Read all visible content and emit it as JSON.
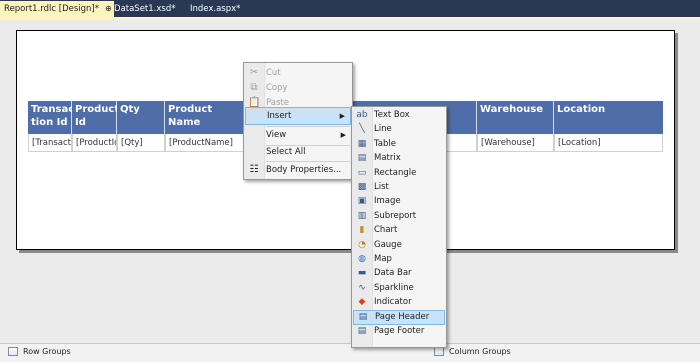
{
  "tabs": [
    {
      "label": "Report1.rdlc [Design]*",
      "active": true
    },
    {
      "label": "DataSet1.xsd*",
      "active": false
    },
    {
      "label": "Index.aspx*",
      "active": false
    }
  ],
  "tablix": {
    "headers": [
      "Transac tion Id",
      "Product Id",
      "Qty",
      "Product Name",
      "",
      "",
      "Warehouse",
      "Location"
    ],
    "row": [
      "[Transactic",
      "[ProductId]",
      "[Qty]",
      "[ProductName]",
      "",
      "",
      "[Warehouse]",
      "[Location]"
    ]
  },
  "context_menu": {
    "items": [
      {
        "label": "Cut",
        "icon": "cut-icon",
        "enabled": false
      },
      {
        "label": "Copy",
        "icon": "copy-icon",
        "enabled": false
      },
      {
        "label": "Paste",
        "icon": "paste-icon",
        "enabled": false
      },
      {
        "label": "Insert",
        "icon": "",
        "enabled": true,
        "submenu": true,
        "highlighted": true
      },
      {
        "label": "View",
        "icon": "",
        "enabled": true,
        "submenu": true
      },
      {
        "label": "Select All",
        "icon": "",
        "enabled": true
      },
      {
        "label": "Body Properties...",
        "icon": "properties-icon",
        "enabled": true
      }
    ]
  },
  "insert_submenu": {
    "items": [
      {
        "label": "Text Box",
        "icon": "textbox-icon"
      },
      {
        "label": "Line",
        "icon": "line-icon"
      },
      {
        "label": "Table",
        "icon": "table-icon"
      },
      {
        "label": "Matrix",
        "icon": "matrix-icon"
      },
      {
        "label": "Rectangle",
        "icon": "rectangle-icon"
      },
      {
        "label": "List",
        "icon": "list-icon"
      },
      {
        "label": "Image",
        "icon": "image-icon"
      },
      {
        "label": "Subreport",
        "icon": "subreport-icon"
      },
      {
        "label": "Chart",
        "icon": "chart-icon"
      },
      {
        "label": "Gauge",
        "icon": "gauge-icon"
      },
      {
        "label": "Map",
        "icon": "map-icon"
      },
      {
        "label": "Data Bar",
        "icon": "databar-icon"
      },
      {
        "label": "Sparkline",
        "icon": "sparkline-icon"
      },
      {
        "label": "Indicator",
        "icon": "indicator-icon"
      },
      {
        "label": "Page Header",
        "icon": "page-header-icon",
        "highlighted": true
      },
      {
        "label": "Page Footer",
        "icon": "page-footer-icon"
      }
    ]
  },
  "statusbar": {
    "row_groups": "Row Groups",
    "column_groups": "Column Groups"
  },
  "colors": {
    "header_fill": "#4f6ea7",
    "tab_active": "#fdf4bf",
    "chrome": "#293955",
    "menu_highlight": "#c9e2f8"
  }
}
